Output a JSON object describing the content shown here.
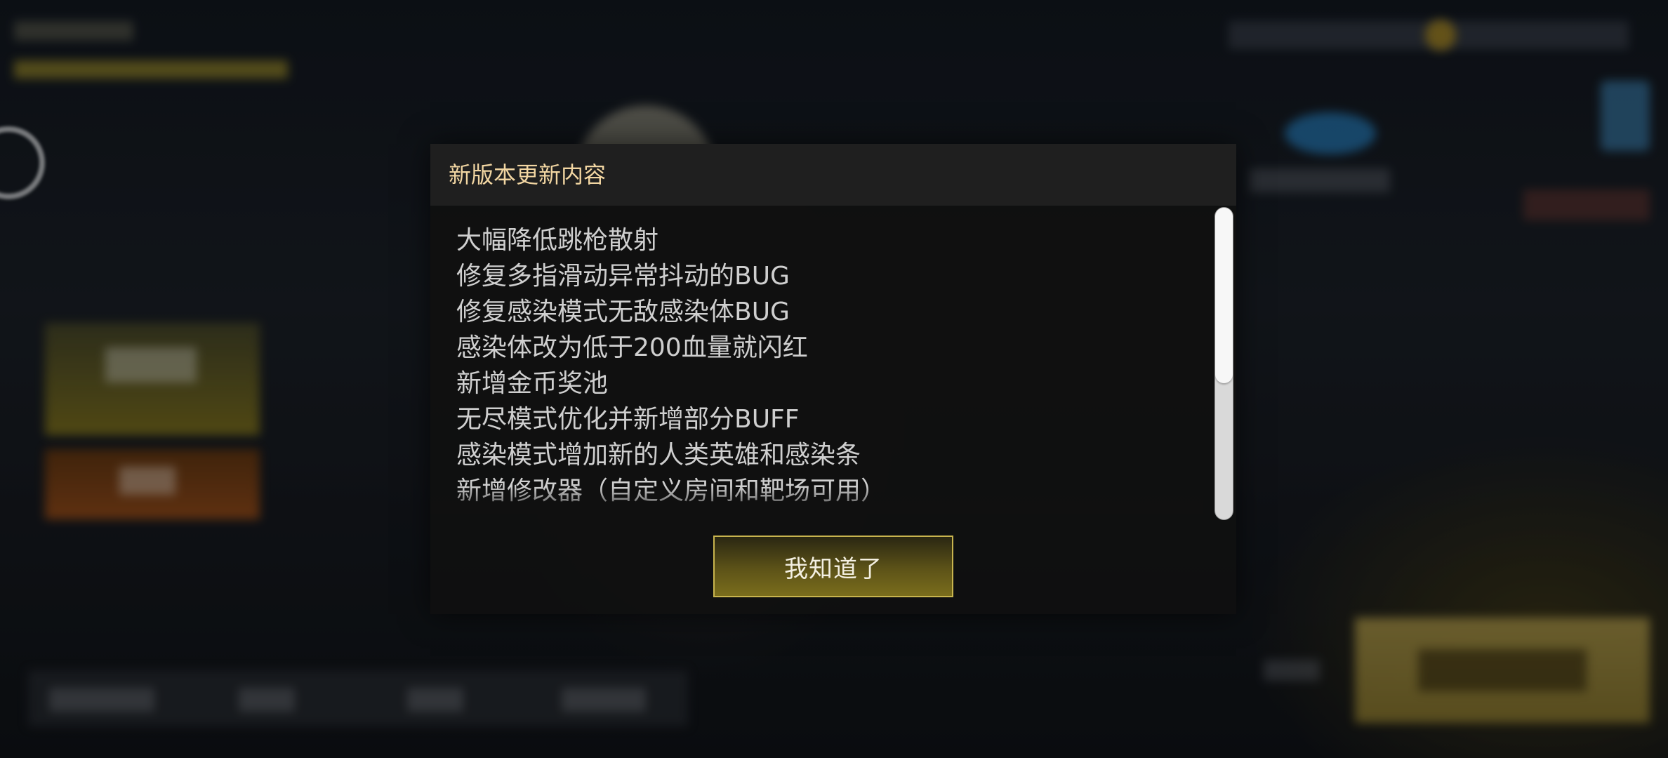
{
  "dialog": {
    "title": "新版本更新内容",
    "notes": [
      "大幅降低跳枪散射",
      "修复多指滑动异常抖动的BUG",
      "修复感染模式无敌感染体BUG",
      "感染体改为低于200血量就闪红",
      "新增金币奖池",
      "无尽模式优化并新增部分BUFF",
      "感染模式增加新的人类英雄和感染条",
      "新增修改器（自定义房间和靶场可用）"
    ],
    "scroll_position": 0.0,
    "confirm_label": "我知道了"
  },
  "colors": {
    "title": "#f2d6a2",
    "note_text": "#cfcfcf",
    "button_border": "#c8b44e",
    "button_fill": "#6a5f1a"
  }
}
